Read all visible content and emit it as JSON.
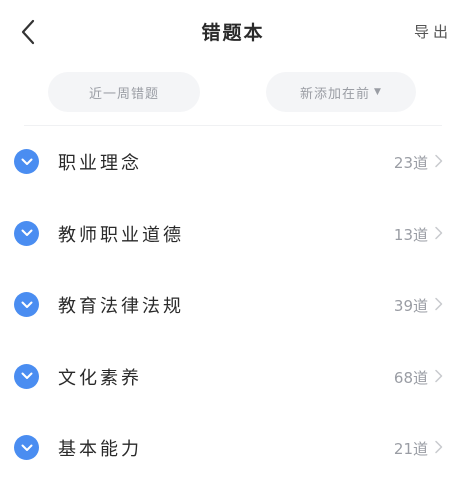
{
  "header": {
    "title": "错题本",
    "export_label": "导出",
    "back_icon": "chevron-left-icon"
  },
  "filters": {
    "week_label": "近一周错题",
    "sort_label": "新添加在前",
    "sort_caret": "▼"
  },
  "colors": {
    "accent": "#4a8df1",
    "muted_text": "#9a9da4",
    "pill_bg": "#f4f5f7"
  },
  "categories": [
    {
      "label": "职业理念",
      "count": "23道"
    },
    {
      "label": "教师职业道德",
      "count": "13道"
    },
    {
      "label": "教育法律法规",
      "count": "39道"
    },
    {
      "label": "文化素养",
      "count": "68道"
    },
    {
      "label": "基本能力",
      "count": "21道"
    }
  ]
}
